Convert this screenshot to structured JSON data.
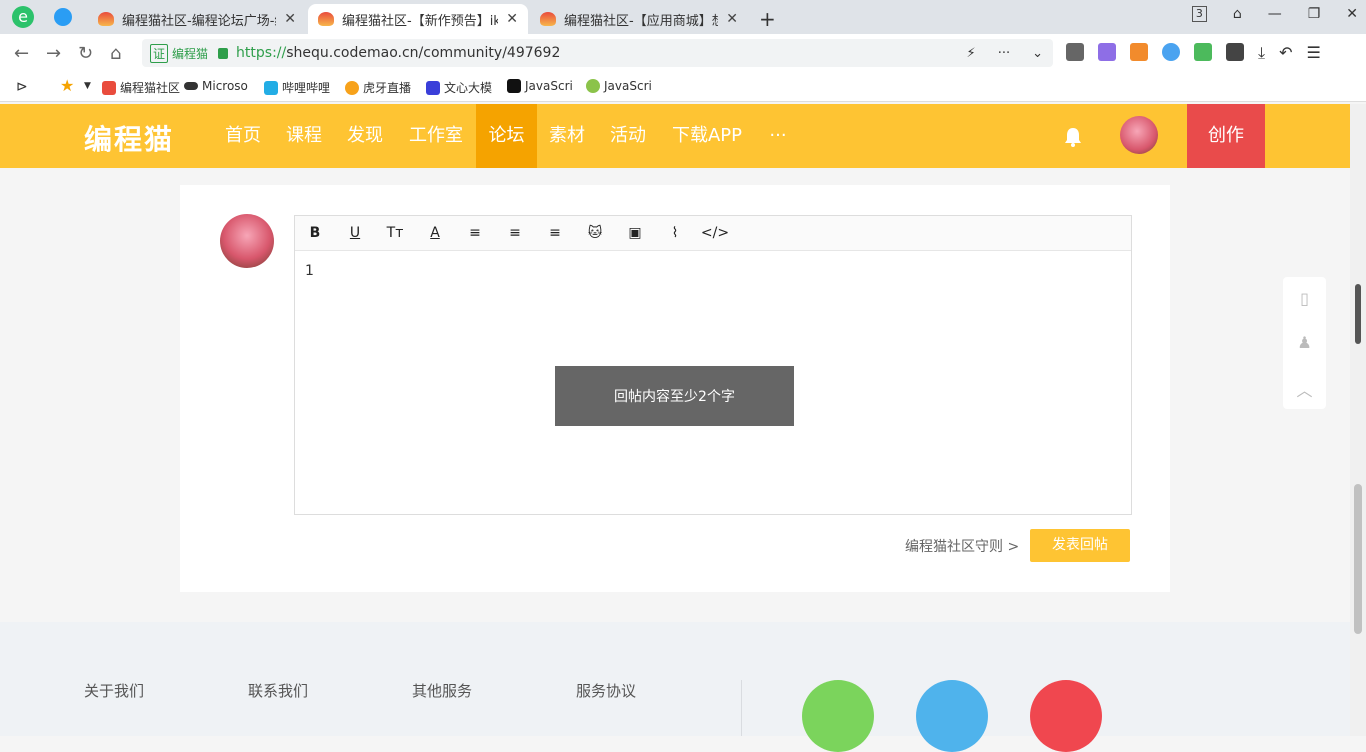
{
  "browser": {
    "tabs": [
      {
        "title": "编程猫社区-编程论坛广场-编程"
      },
      {
        "title": "编程猫社区-【新作预告】ikun"
      },
      {
        "title": "编程猫社区-【应用商城】想搞"
      }
    ],
    "tab_count": "3",
    "url_cert_label": "证",
    "url_cert_name": "编程猫",
    "url_scheme": "https://",
    "url_rest": "shequ.codemao.cn/community/497692",
    "bookmarks": [
      {
        "label": "编程猫社区"
      },
      {
        "label": "Microso"
      },
      {
        "label": "哔哩哔哩"
      },
      {
        "label": "虎牙直播"
      },
      {
        "label": "文心大模"
      },
      {
        "label": "JavaScri"
      },
      {
        "label": "JavaScri"
      }
    ]
  },
  "site": {
    "logo_text": "编程猫",
    "nav": [
      "首页",
      "课程",
      "发现",
      "工作室",
      "论坛",
      "素材",
      "活动",
      "下载APP",
      "···"
    ],
    "create_label": "创作"
  },
  "reply": {
    "content": "1",
    "toast": "回帖内容至少2个字",
    "rules_link": "编程猫社区守则 >",
    "submit_label": "发表回帖"
  },
  "footer": {
    "columns": [
      "关于我们",
      "联系我们",
      "其他服务",
      "服务协议"
    ]
  },
  "colors": {
    "brand_yellow": "#fec433",
    "create_red": "#e94b4b",
    "nav_active": "#f5a300"
  }
}
